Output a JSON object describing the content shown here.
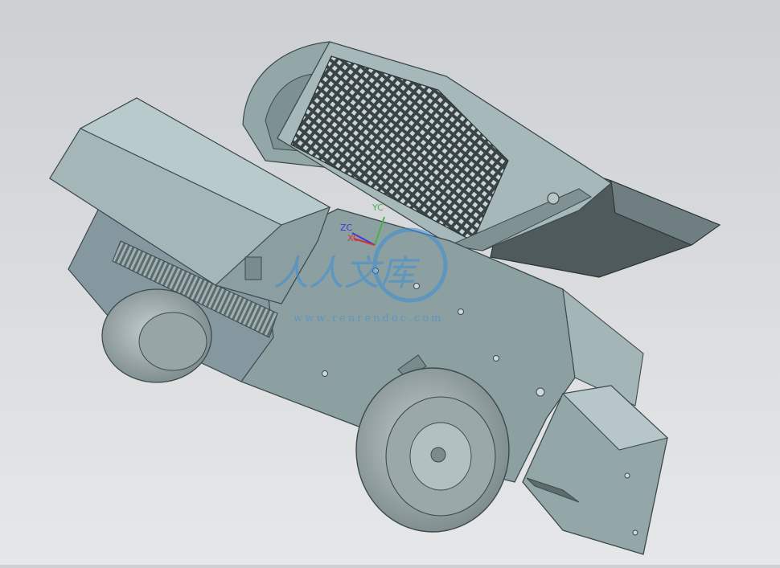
{
  "viewport": {
    "background_top": "#cdd0d3",
    "background_bottom": "#e6e7e9"
  },
  "model": {
    "body_color": "#93a6a8",
    "body_dark": "#6f8284",
    "body_light": "#b9cacc",
    "tire_color": "#a9b5b7",
    "mesh_color": "#3a4446",
    "chute_dark": "#4e5a5c"
  },
  "triad": {
    "yc_label": "YC",
    "zc_label": "ZC",
    "xc_label": "XC",
    "yc_color": "#4caf50",
    "zc_color": "#2f3fd6",
    "xc_color": "#d6303a"
  },
  "watermark": {
    "main_text": "人人文库",
    "sub_text": "www.renrendoc.com",
    "color": "#3a8fd6"
  }
}
